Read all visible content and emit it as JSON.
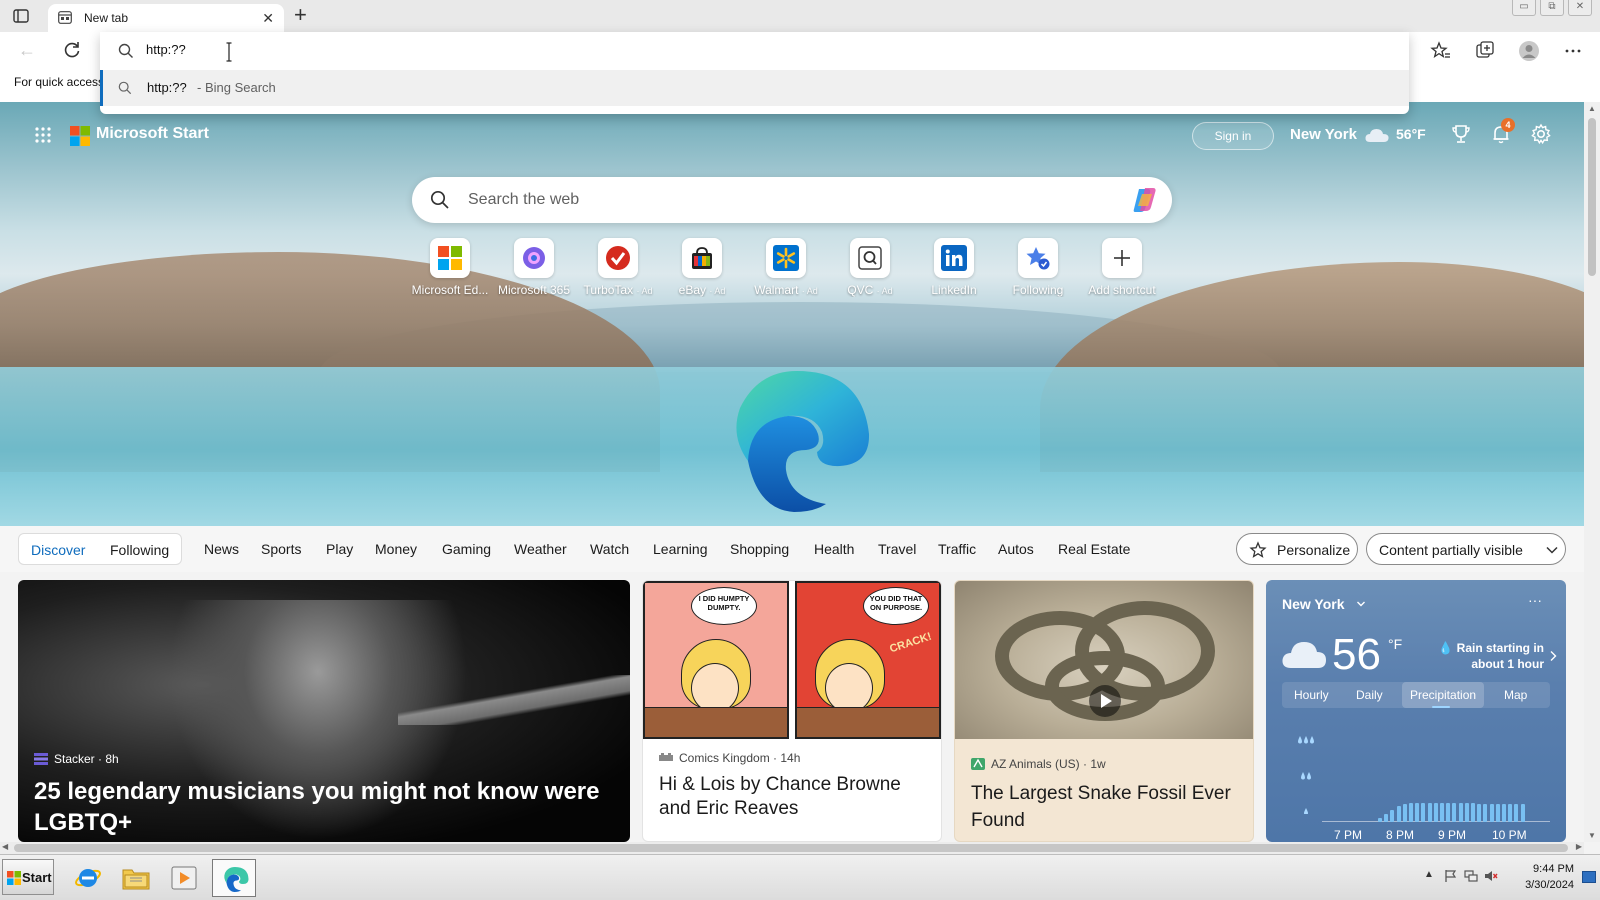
{
  "browser": {
    "tab": {
      "title": "New tab",
      "close": "✕"
    },
    "new_tab": "+",
    "window_controls": [
      "▭",
      "⧉",
      "✕"
    ],
    "quick_access": "For quick access",
    "omnibox": {
      "value": "http:??",
      "suggestion": {
        "query": "http:??",
        "source": "- Bing Search"
      }
    },
    "toolbar_icons": [
      "favorites-star-icon",
      "collections-icon",
      "profile-avatar-icon",
      "more-menu-icon"
    ]
  },
  "newtab": {
    "brand": "Microsoft Start",
    "sign_in": "Sign in",
    "location": "New York",
    "temp": "56°F",
    "notification_count": "4",
    "search_placeholder": "Search the web",
    "shortcuts": [
      {
        "label": "Microsoft Ed...",
        "ad": "",
        "icon": "microsoft-edge-shortcut-icon"
      },
      {
        "label": "Microsoft 365",
        "ad": "",
        "icon": "microsoft-365-icon"
      },
      {
        "label": "TurboTax",
        "ad": "· Ad",
        "icon": "turbotax-icon"
      },
      {
        "label": "eBay",
        "ad": "· Ad",
        "icon": "ebay-icon"
      },
      {
        "label": "Walmart",
        "ad": "· Ad",
        "icon": "walmart-icon"
      },
      {
        "label": "QVC",
        "ad": "· Ad",
        "icon": "qvc-icon"
      },
      {
        "label": "LinkedIn",
        "ad": "",
        "icon": "linkedin-icon"
      },
      {
        "label": "Following",
        "ad": "",
        "icon": "following-icon"
      },
      {
        "label": "Add shortcut",
        "ad": "",
        "icon": "plus-icon"
      }
    ]
  },
  "nav": {
    "discover": "Discover",
    "following": "Following",
    "items": [
      "News",
      "Sports",
      "Play",
      "Money",
      "Gaming",
      "Weather",
      "Watch",
      "Learning",
      "Shopping",
      "Health",
      "Travel",
      "Traffic",
      "Autos",
      "Real Estate"
    ],
    "personalize": "Personalize",
    "content_visibility": "Content partially visible"
  },
  "cards": {
    "featured": {
      "source": "Stacker · 8h",
      "headline": "25 legendary musicians you might not know were LGBTQ+"
    },
    "comic": {
      "source": "Comics Kingdom · 14h",
      "headline": "Hi & Lois by Chance Browne and Eric Reaves",
      "bubble1": "I DID HUMPTY DUMPTY.",
      "bubble2": "YOU DID THAT ON PURPOSE.",
      "sfx": "CRACK!"
    },
    "snake": {
      "source": "AZ Animals (US) · 1w",
      "headline": "The Largest Snake Fossil Ever Found"
    },
    "weather": {
      "location": "New York",
      "more": "···",
      "temp": "56",
      "unit": "°F",
      "rain_line1": "Rain starting in",
      "rain_line2": "about 1 hour",
      "tabs": [
        "Hourly",
        "Daily",
        "Precipitation",
        "Map"
      ],
      "active_tab": "Precipitation",
      "times": [
        "7 PM",
        "8 PM",
        "9 PM",
        "10 PM"
      ]
    }
  },
  "taskbar": {
    "start": "Start",
    "apps": [
      "internet-explorer-icon",
      "file-explorer-icon",
      "media-player-icon",
      "edge-browser-icon"
    ],
    "time": "9:44 PM",
    "date": "3/30/2024"
  }
}
